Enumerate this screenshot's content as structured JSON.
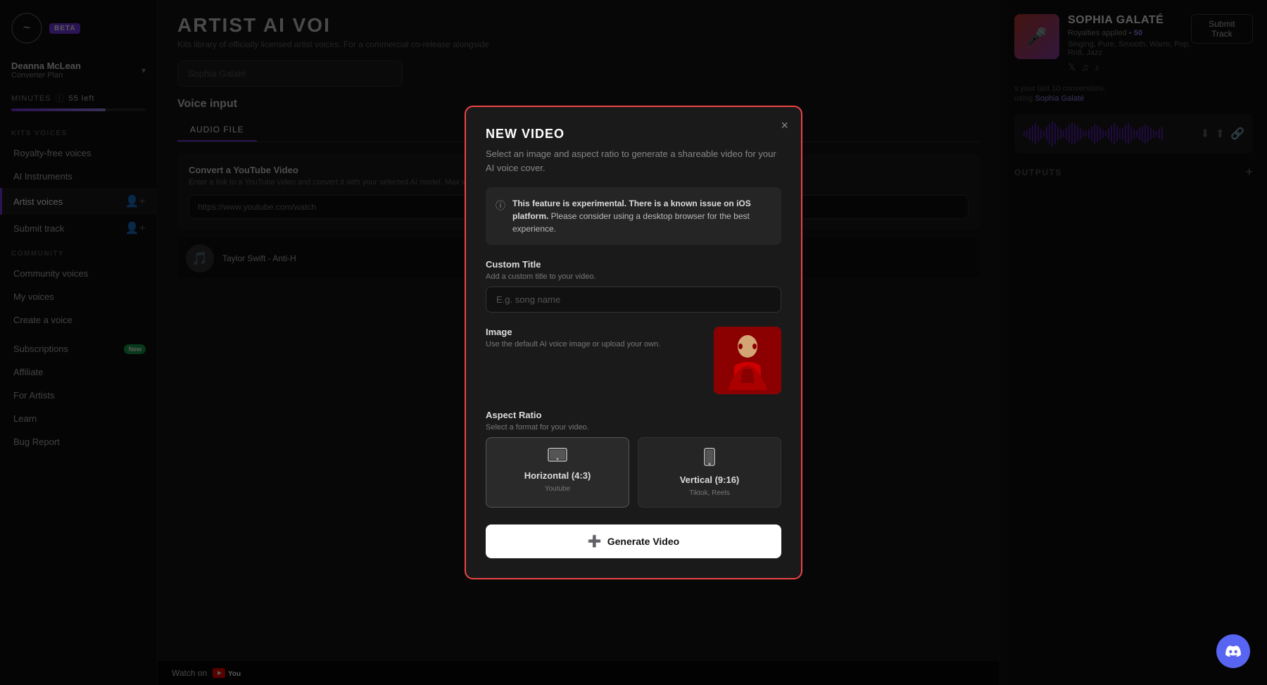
{
  "app": {
    "logo_text": "~",
    "beta_label": "BETA"
  },
  "user": {
    "name": "Deanna McLean",
    "plan": "Converter Plan",
    "minutes_label": "MINUTES",
    "minutes_left": "55 left",
    "progress_percent": 70
  },
  "sidebar": {
    "sections": {
      "kits_voices_label": "KITS VOICES",
      "community_label": "COMMUNITY"
    },
    "kits_items": [
      {
        "label": "Royalty-free voices",
        "active": false
      },
      {
        "label": "AI Instruments",
        "active": false
      },
      {
        "label": "Artist voices",
        "active": true
      },
      {
        "label": "Submit track",
        "active": false
      }
    ],
    "community_items": [
      {
        "label": "Community voices",
        "active": false
      },
      {
        "label": "My voices",
        "active": false
      },
      {
        "label": "Create a voice",
        "active": false
      }
    ],
    "bottom_items": [
      {
        "label": "Subscriptions",
        "badge": "New",
        "active": false
      },
      {
        "label": "Affiliate",
        "active": false
      },
      {
        "label": "For Artists",
        "active": false
      },
      {
        "label": "Learn",
        "active": false
      },
      {
        "label": "Bug Report",
        "active": false
      }
    ]
  },
  "main": {
    "title": "ARTIST AI VOI",
    "subtitle": "Kits library of officially licensed artist voices. For a commercial co-release alongside",
    "search_placeholder": "Sophia Galaté",
    "voice_input_title": "Voice input",
    "tabs": [
      {
        "label": "AUDIO FILE",
        "active": true
      }
    ],
    "convert": {
      "title": "Convert a YouTube Video",
      "description": "Enter a link to a YouTube video and convert it with your selected AI model. Max video lengt",
      "url_placeholder": "https://www.youtube.com/watch",
      "url_value": "https://www.youtube.com/watc"
    },
    "video_preview": {
      "title": "Taylor Swift - Anti-H"
    },
    "watch_on_yt": "Watch on"
  },
  "right_panel": {
    "submit_track_label": "Submit Track",
    "artist_name": "SOPHIA GALATÉ",
    "royalties_label": "Royalties applied •",
    "royalties_count": "50",
    "tags": "Singing, Pure, Smooth, Warm, Pop, Rn8, Jazz",
    "social": [
      "twitter",
      "spotify",
      "tiktok"
    ],
    "last_10_label": "s your last 10 conversions.",
    "using_label": "using",
    "using_artist": "Sophia Galaté",
    "outputs_label": "OUTPUTS"
  },
  "modal": {
    "title": "NEW VIDEO",
    "subtitle": "Select an image and aspect ratio to generate a shareable video for your AI voice cover.",
    "close_label": "×",
    "warning": {
      "text": "This feature is experimental. There is a known issue on iOS platform. Please consider using a desktop browser for the best experience."
    },
    "custom_title_label": "Custom Title",
    "custom_title_desc": "Add a custom title to your video.",
    "custom_title_placeholder": "E.g. song name",
    "image_label": "Image",
    "image_desc": "Use the default AI voice image or upload your own.",
    "aspect_ratio_label": "Aspect Ratio",
    "aspect_ratio_desc": "Select a format for your video.",
    "aspect_options": [
      {
        "label": "Horizontal (4:3)",
        "platform": "Youtube",
        "selected": true,
        "icon": "🖥"
      },
      {
        "label": "Vertical (9:16)",
        "platform": "Tiktok, Reels",
        "selected": false,
        "icon": "📱"
      }
    ],
    "generate_button_label": "Generate Video"
  }
}
